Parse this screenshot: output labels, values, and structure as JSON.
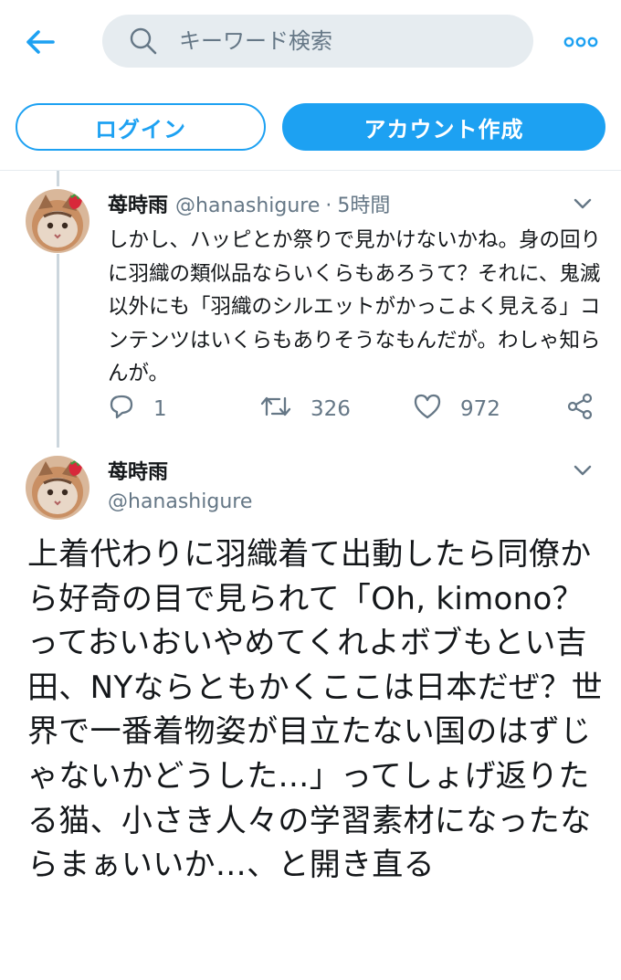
{
  "header": {
    "search_placeholder": "キーワード検索"
  },
  "auth": {
    "login_label": "ログイン",
    "signup_label": "アカウント作成"
  },
  "colors": {
    "accent": "#1da1f2",
    "secondary_text": "#657786",
    "search_bg": "#e6ecf0"
  },
  "reply_tweet": {
    "name": "苺時雨",
    "handle": "@hanashigure",
    "separator": "·",
    "time": "5時間",
    "text": "しかし、ハッピとか祭りで見かけないかね。身の回りに羽織の類似品ならいくらもあろうて？それに、鬼滅以外にも「羽織のシルエットがかっこよく見える」コンテンツはいくらもありそうなもんだが。わしゃ知らんが。",
    "reply_count": "1",
    "retweet_count": "326",
    "like_count": "972"
  },
  "main_tweet": {
    "name": "苺時雨",
    "handle": "@hanashigure",
    "text": "上着代わりに羽織着て出動したら同僚から好奇の目で見られて「Oh, kimono？っておいおいやめてくれよボブもとい吉田、NYならともかくここは日本だぜ？世界で一番着物姿が目立たない国のはずじゃないかどうした…」ってしょげ返りたる猫、小さき人々の学習素材になったならまぁいいか…、と開き直る"
  },
  "icons": [
    "back-arrow-icon",
    "search-icon",
    "more-dots-icon",
    "chevron-down-icon",
    "reply-icon",
    "retweet-icon",
    "like-icon",
    "share-icon"
  ]
}
